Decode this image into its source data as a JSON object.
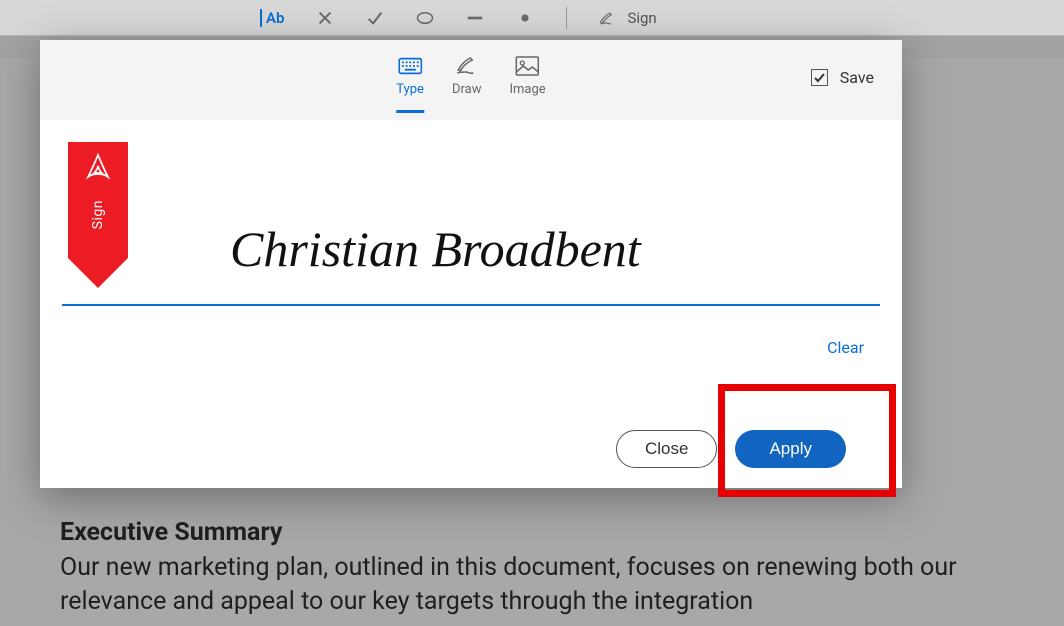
{
  "toolbar": {
    "ab_label": "Ab",
    "sign_label": "Sign"
  },
  "modal": {
    "tabs": {
      "type": "Type",
      "draw": "Draw",
      "image": "Image"
    },
    "save_label": "Save",
    "ribbon_label": "Sign",
    "signature": "Christian Broadbent",
    "clear_label": "Clear",
    "close_label": "Close",
    "apply_label": "Apply"
  },
  "document": {
    "heading": "Executive Summary",
    "body": "Our new marketing plan, outlined in this document, focuses on renewing both our relevance and appeal to our key targets through the integration"
  }
}
